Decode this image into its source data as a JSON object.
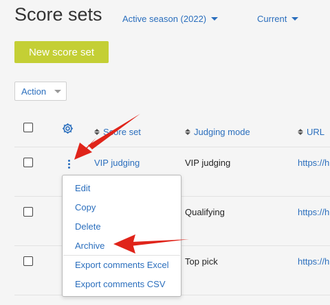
{
  "page": {
    "title": "Score sets"
  },
  "filters": {
    "season": "Active season (2022)",
    "status": "Current"
  },
  "toolbar": {
    "new_button": "New score set",
    "action_button": "Action"
  },
  "table": {
    "columns": [
      "Score set",
      "Judging mode",
      "URL"
    ],
    "rows": [
      {
        "score_set": "VIP judging",
        "judging_mode": "VIP judging",
        "url": "https://h"
      },
      {
        "score_set": "",
        "judging_mode": "Qualifying",
        "url": "https://h"
      },
      {
        "score_set": "",
        "judging_mode": "Top pick",
        "url": "https://h"
      }
    ]
  },
  "context_menu": {
    "items": [
      "Edit",
      "Copy",
      "Delete",
      "Archive",
      "Export comments Excel",
      "Export comments CSV"
    ]
  },
  "colors": {
    "accent": "#2a6ebd",
    "primary_button": "#c4cf35",
    "annotation_arrow": "#e0241a"
  },
  "icons": {
    "settings": "gear-icon",
    "row_menu": "kebab-menu-icon",
    "sort": "sort-icon"
  }
}
